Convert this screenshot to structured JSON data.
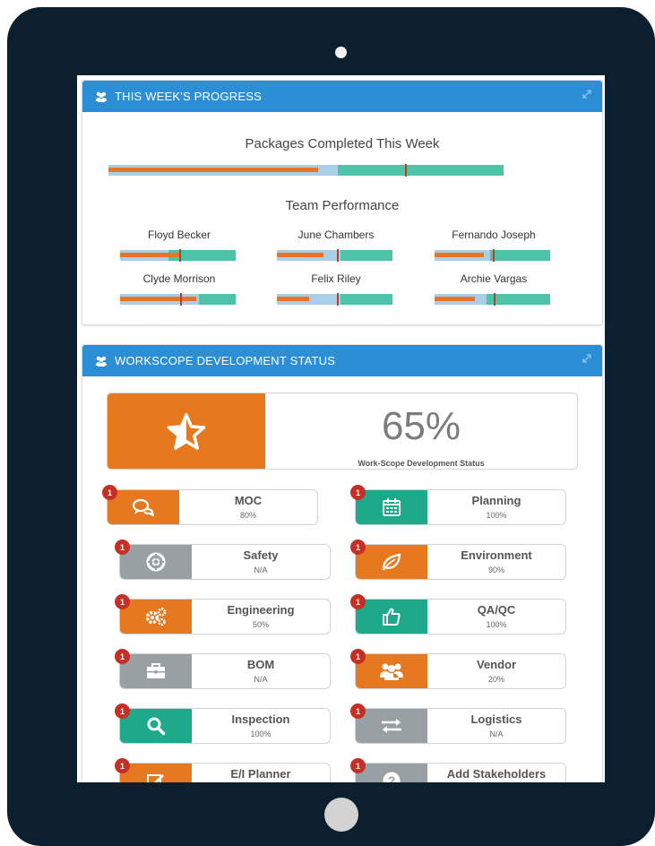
{
  "colors": {
    "accent": "#2c8fd6",
    "orange": "#e6791f",
    "teal": "#1ea98a",
    "grey": "#98a0a3",
    "badge": "#c43025"
  },
  "progress_panel": {
    "title": "THIS WEEK'S PROGRESS",
    "packages_title": "Packages Completed This Week",
    "packages_bar": {
      "light_fraction": 0.58,
      "orange_fraction": 0.53,
      "marker_fraction": 0.75
    },
    "team_title": "Team Performance",
    "members": [
      {
        "name": "Floyd Becker",
        "peach": 0.2,
        "light": 0.42,
        "orange": 0.52,
        "marker": 0.51
      },
      {
        "name": "June Chambers",
        "peach": 0.0,
        "light": 0.55,
        "orange": 0.4,
        "marker": 0.52
      },
      {
        "name": "Fernando Joseph",
        "peach": 0.0,
        "light": 0.48,
        "orange": 0.43,
        "marker": 0.5
      },
      {
        "name": "Clyde Morrison",
        "peach": 0.22,
        "light": 0.68,
        "orange": 0.66,
        "marker": 0.52
      },
      {
        "name": "Felix Riley",
        "peach": 0.0,
        "light": 0.55,
        "orange": 0.28,
        "marker": 0.52
      },
      {
        "name": "Archie Vargas",
        "peach": 0.0,
        "light": 0.45,
        "orange": 0.35,
        "marker": 0.51
      }
    ]
  },
  "workscope_panel": {
    "title": "WORKSCOPE DEVELOPMENT STATUS",
    "overall_value": "65%",
    "overall_caption": "Work-Scope Development Status",
    "tiles": [
      {
        "label": "MOC",
        "value": "80%",
        "badge": "1",
        "color": "orange",
        "icon": "comments-icon"
      },
      {
        "label": "Planning",
        "value": "100%",
        "badge": "1",
        "color": "teal",
        "icon": "calendar-icon"
      },
      {
        "label": "Safety",
        "value": "N/A",
        "badge": "1",
        "color": "grey",
        "icon": "lifebuoy-icon"
      },
      {
        "label": "Environment",
        "value": "90%",
        "badge": "1",
        "color": "orange",
        "icon": "leaf-icon"
      },
      {
        "label": "Engineering",
        "value": "50%",
        "badge": "1",
        "color": "orange",
        "icon": "gears-icon"
      },
      {
        "label": "QA/QC",
        "value": "100%",
        "badge": "1",
        "color": "teal",
        "icon": "thumbs-up-icon"
      },
      {
        "label": "BOM",
        "value": "N/A",
        "badge": "1",
        "color": "grey",
        "icon": "briefcase-icon"
      },
      {
        "label": "Vendor",
        "value": "20%",
        "badge": "1",
        "color": "orange",
        "icon": "users-icon"
      },
      {
        "label": "Inspection",
        "value": "100%",
        "badge": "1",
        "color": "teal",
        "icon": "search-icon"
      },
      {
        "label": "Logistics",
        "value": "N/A",
        "badge": "1",
        "color": "grey",
        "icon": "exchange-icon"
      },
      {
        "label": "E/I Planner",
        "value": "",
        "badge": "1",
        "color": "orange",
        "icon": "edit-icon"
      },
      {
        "label": "Add Stakeholders",
        "value": "",
        "badge": "1",
        "color": "grey",
        "icon": "question-icon"
      }
    ]
  }
}
